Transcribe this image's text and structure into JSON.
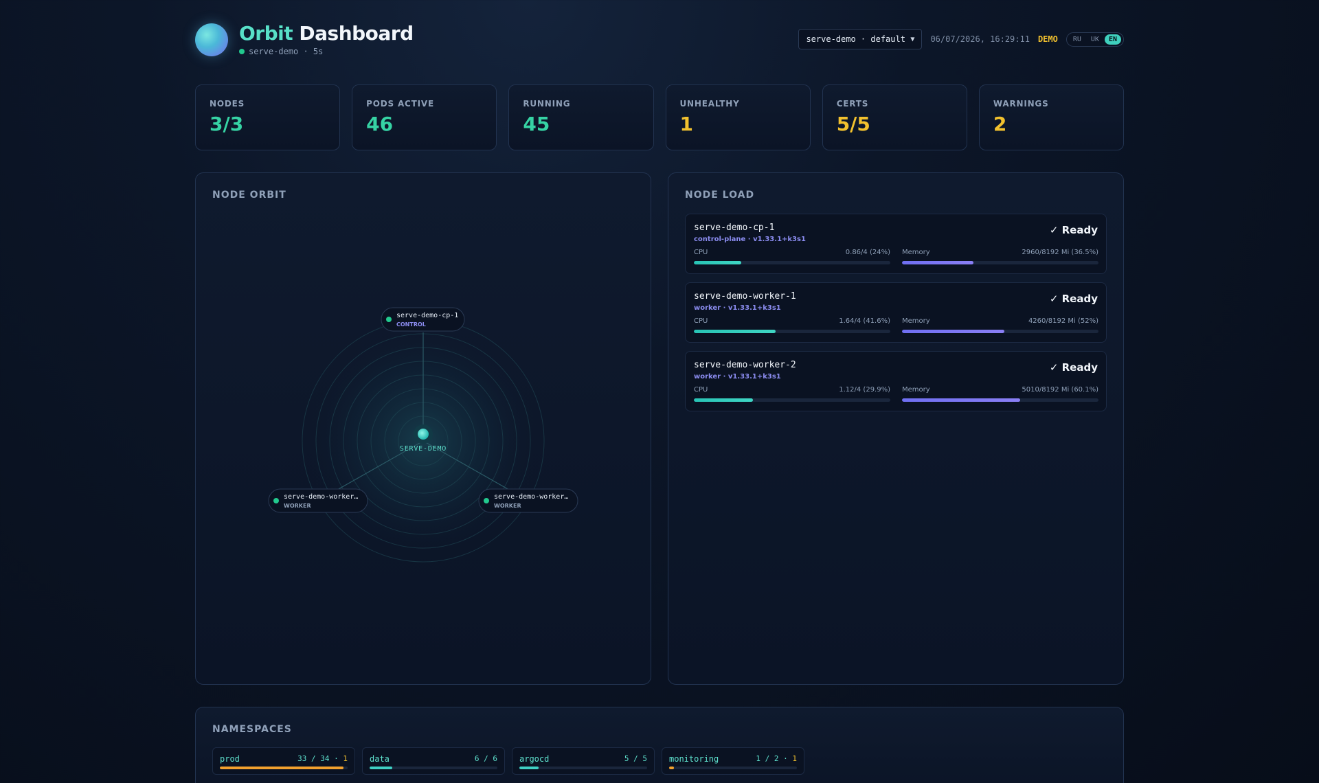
{
  "header": {
    "brand_part1": "Orbit",
    "brand_part2": "Dashboard",
    "subline": "serve-demo · 5s",
    "context_select": "serve-demo · default",
    "clock": "06/07/2026, 16:29:11",
    "demo_badge": "DEMO",
    "languages": [
      "RU",
      "UK",
      "EN"
    ],
    "active_language": "EN"
  },
  "stats": [
    {
      "label": "NODES",
      "value": "3/3",
      "color": "#36d3a4"
    },
    {
      "label": "PODS ACTIVE",
      "value": "46",
      "color": "#36d3a4"
    },
    {
      "label": "RUNNING",
      "value": "45",
      "color": "#36d3a4"
    },
    {
      "label": "UNHEALTHY",
      "value": "1",
      "color": "#f2c12e"
    },
    {
      "label": "CERTS",
      "value": "5/5",
      "color": "#f2c12e"
    },
    {
      "label": "WARNINGS",
      "value": "2",
      "color": "#f2c12e"
    }
  ],
  "orbit": {
    "title": "NODE ORBIT",
    "center_label": "SERVE-DEMO",
    "nodes": [
      {
        "name": "serve-demo-cp-1",
        "role": "CONTROL",
        "role_color": "#8b8cf0"
      },
      {
        "name": "serve-demo-worker…",
        "role": "WORKER",
        "role_color": "#8fa0b8"
      },
      {
        "name": "serve-demo-worker…",
        "role": "WORKER",
        "role_color": "#8fa0b8"
      }
    ]
  },
  "node_load": {
    "title": "NODE LOAD",
    "cards": [
      {
        "name": "serve-demo-cp-1",
        "meta": "control-plane · v1.33.1+k3s1",
        "status": "✓ Ready",
        "cpu_label": "CPU",
        "cpu_value": "0.86/4 (24%)",
        "cpu_pct": 24,
        "mem_label": "Memory",
        "mem_value": "2960/8192 Mi (36.5%)",
        "mem_pct": 36.5
      },
      {
        "name": "serve-demo-worker-1",
        "meta": "worker · v1.33.1+k3s1",
        "status": "✓ Ready",
        "cpu_label": "CPU",
        "cpu_value": "1.64/4 (41.6%)",
        "cpu_pct": 41.6,
        "mem_label": "Memory",
        "mem_value": "4260/8192 Mi (52%)",
        "mem_pct": 52
      },
      {
        "name": "serve-demo-worker-2",
        "meta": "worker · v1.33.1+k3s1",
        "status": "✓ Ready",
        "cpu_label": "CPU",
        "cpu_value": "1.12/4 (29.9%)",
        "cpu_pct": 29.9,
        "mem_label": "Memory",
        "mem_value": "5010/8192 Mi (60.1%)",
        "mem_pct": 60.1
      }
    ]
  },
  "namespaces": {
    "title": "NAMESPACES",
    "items": [
      {
        "name": "prod",
        "counts": "33 / 34 ·",
        "warn": "1",
        "pct": 97,
        "color": "#f2a12e"
      },
      {
        "name": "data",
        "counts": "6 / 6",
        "warn": "",
        "pct": 18,
        "color": "#3fd0c4"
      },
      {
        "name": "argocd",
        "counts": "5 / 5",
        "warn": "",
        "pct": 15,
        "color": "#3fd0c4"
      },
      {
        "name": "monitoring",
        "counts": "1 / 2 ·",
        "warn": "1",
        "pct": 4,
        "color": "#f2a12e"
      }
    ]
  }
}
